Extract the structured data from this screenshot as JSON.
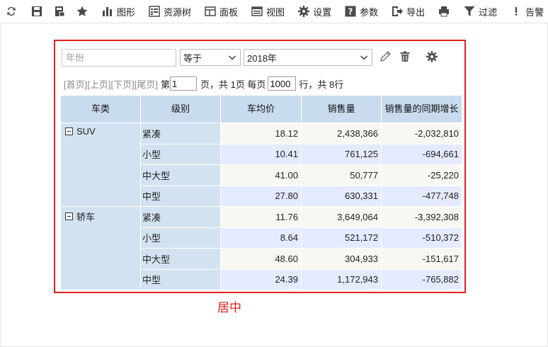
{
  "toolbar": {
    "refresh_icon": "refresh-icon",
    "save_icon": "save-icon",
    "save_as_icon": "save-as-icon",
    "favorite_icon": "star-icon",
    "items": [
      {
        "label": "图形",
        "icon": "bar-chart-icon"
      },
      {
        "label": "资源树",
        "icon": "resource-tree-icon"
      },
      {
        "label": "面板",
        "icon": "panel-icon"
      },
      {
        "label": "视图",
        "icon": "view-icon"
      },
      {
        "label": "设置",
        "icon": "gear-icon"
      },
      {
        "label": "参数",
        "icon": "help-icon"
      },
      {
        "label": "导出",
        "icon": "export-icon"
      },
      {
        "label": "",
        "icon": "print-icon"
      },
      {
        "label": "过滤",
        "icon": "filter-icon"
      },
      {
        "label": "告警",
        "icon": "alert-icon"
      }
    ]
  },
  "filter": {
    "field_placeholder": "年份",
    "operator": "等于",
    "value": "2018年"
  },
  "pager": {
    "first": "[首页]",
    "prev": "[上页]",
    "next": "[下页]",
    "last": "[尾页]",
    "prefix": "第",
    "page": "1",
    "middle": "页，共 1页 每页",
    "page_size": "1000",
    "suffix": "行，共 8行"
  },
  "table": {
    "headers": [
      "车类",
      "级别",
      "车均价",
      "销售量",
      "销售量的同期增长"
    ],
    "groups": [
      {
        "name": "SUV",
        "rows": [
          {
            "level": "紧凑",
            "avg_price": "18.12",
            "sales": "2,438,366",
            "growth": "-2,032,810"
          },
          {
            "level": "小型",
            "avg_price": "10.41",
            "sales": "761,125",
            "growth": "-694,661"
          },
          {
            "level": "中大型",
            "avg_price": "41.00",
            "sales": "50,777",
            "growth": "-25,220"
          },
          {
            "level": "中型",
            "avg_price": "27.80",
            "sales": "630,331",
            "growth": "-477,748"
          }
        ]
      },
      {
        "name": "轿车",
        "rows": [
          {
            "level": "紧凑",
            "avg_price": "11.76",
            "sales": "3,649,064",
            "growth": "-3,392,308"
          },
          {
            "level": "小型",
            "avg_price": "8.64",
            "sales": "521,172",
            "growth": "-510,372"
          },
          {
            "level": "中大型",
            "avg_price": "48.60",
            "sales": "304,933",
            "growth": "-151,617"
          },
          {
            "level": "中型",
            "avg_price": "24.39",
            "sales": "1,172,943",
            "growth": "-765,882"
          }
        ]
      }
    ]
  },
  "caption": "居中",
  "colors": {
    "accent_red": "#e02020",
    "header_bg": "#c9dbef",
    "dim_bg": "#d3e2f1",
    "row_odd_bg": "#f8f7f2",
    "row_even_bg": "#e4eaff"
  }
}
